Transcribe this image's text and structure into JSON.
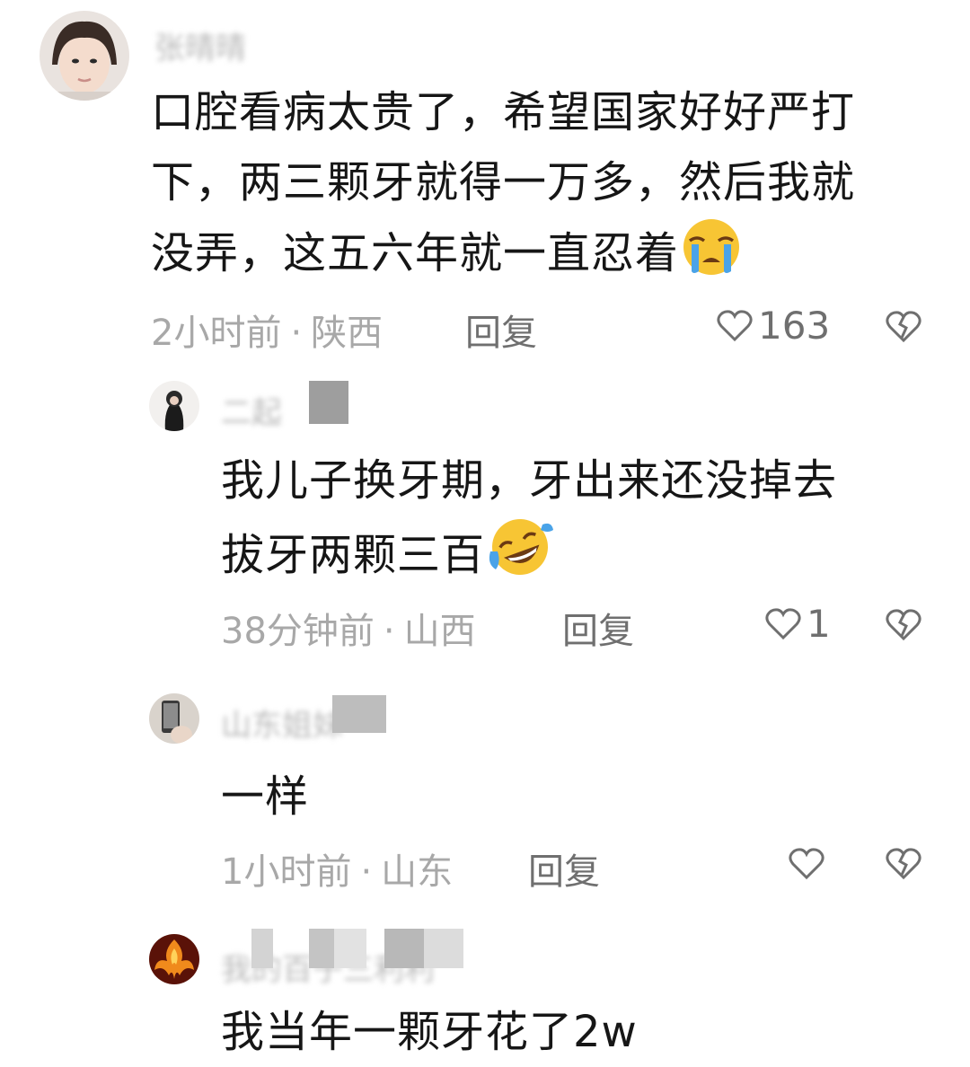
{
  "comments": [
    {
      "username": "张晴晴",
      "text_lines": [
        "口腔看病太贵了，希望国家好好严打",
        "下，两三颗牙就得一万多，然后我就",
        "没弄，这五六年就一直忍着"
      ],
      "emoji": "crying-face",
      "time": "2小时前",
      "location": "陕西",
      "reply_label": "回复",
      "like_count": "163"
    },
    {
      "username": "二起",
      "text_lines": [
        "我儿子换牙期，牙出来还没掉去",
        "拔牙两颗三百"
      ],
      "emoji": "rolling-laughing-face",
      "time": "38分钟前",
      "location": "山西",
      "reply_label": "回复",
      "like_count": "1"
    },
    {
      "username": "山东姐妹",
      "text_lines": [
        "一样"
      ],
      "time": "1小时前",
      "location": "山东",
      "reply_label": "回复",
      "like_count": ""
    },
    {
      "username": "我的百子三利利",
      "text_lines": [
        "我当年一颗牙花了2w"
      ]
    }
  ],
  "separator": "·"
}
